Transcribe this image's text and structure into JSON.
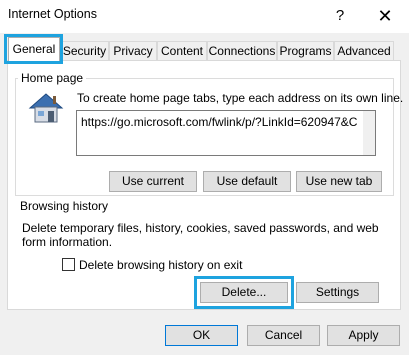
{
  "window": {
    "title": "Internet Options",
    "help_glyph": "?",
    "close_glyph": "✕"
  },
  "tabs": [
    "General",
    "Security",
    "Privacy",
    "Content",
    "Connections",
    "Programs",
    "Advanced"
  ],
  "home_page": {
    "group_label": "Home page",
    "instructions": "To create home page tabs, type each address on its own line.",
    "url": "https://go.microsoft.com/fwlink/p/?LinkId=620947&C",
    "buttons": {
      "use_current": "Use current",
      "use_default": "Use default",
      "use_new_tab": "Use new tab"
    }
  },
  "browsing_history": {
    "group_label": "Browsing history",
    "description_line1": "Delete temporary files, history, cookies, saved passwords, and web",
    "description_line2": "form information.",
    "checkbox_label": "Delete browsing history on exit",
    "buttons": {
      "delete": "Delete...",
      "settings": "Settings"
    }
  },
  "footer": {
    "ok": "OK",
    "cancel": "Cancel",
    "apply": "Apply"
  },
  "colors": {
    "highlight": "#1ea3df",
    "focus_border": "#0078d7",
    "house_roof": "#3b6fb0"
  },
  "icons": {
    "home": "house-icon"
  }
}
